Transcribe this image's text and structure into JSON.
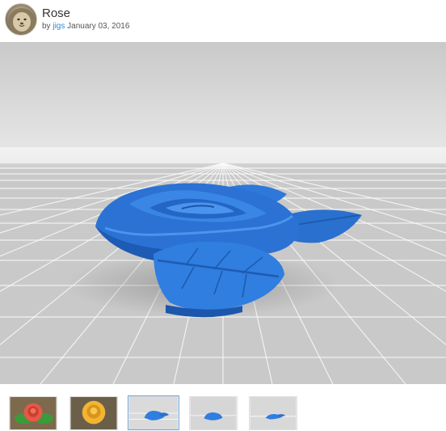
{
  "thing": {
    "title": "Rose",
    "by_prefix": "by",
    "author": "jigs",
    "date": "January 03, 2016"
  },
  "viewer": {
    "model_color": "#2f7ee0",
    "floor_color": "#cfcfcf"
  },
  "thumbnails": [
    {
      "name": "thumb-red-rose",
      "color": "#e8574a",
      "selected": false
    },
    {
      "name": "thumb-yellow-rose",
      "color": "#f2b531",
      "selected": false
    },
    {
      "name": "thumb-blue-rose-front",
      "color": "#2f7ee0",
      "selected": true
    },
    {
      "name": "thumb-blue-rose-angle",
      "color": "#2f7ee0",
      "selected": false
    },
    {
      "name": "thumb-blue-rose-side",
      "color": "#2f7ee0",
      "selected": false
    }
  ]
}
